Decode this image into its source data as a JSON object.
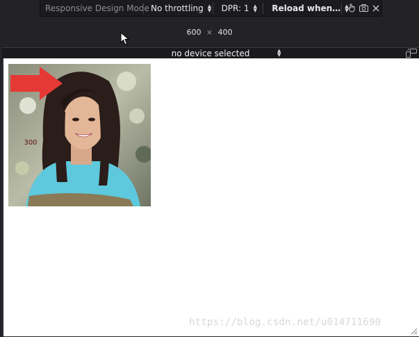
{
  "toolbar": {
    "title": "Responsive Design Mode",
    "throttling": "No throttling",
    "dpr": "DPR: 1",
    "reload": "Reload when…",
    "icons": [
      "touch-icon",
      "camera-icon",
      "close-icon"
    ]
  },
  "size": {
    "width": "600",
    "separator": "×",
    "height": "400"
  },
  "device": {
    "selected": "no device selected",
    "rotate_icon": "rotate-icon"
  },
  "viewport": {
    "image_alt": "portrait photo",
    "arrow_label": "300",
    "watermark": "https://blog.csdn.net/u014711690"
  },
  "colors": {
    "toolbar_bg": "#1b1b1f",
    "background": "#232327",
    "viewport_bg": "#ffffff",
    "arrow": "#e53935"
  }
}
